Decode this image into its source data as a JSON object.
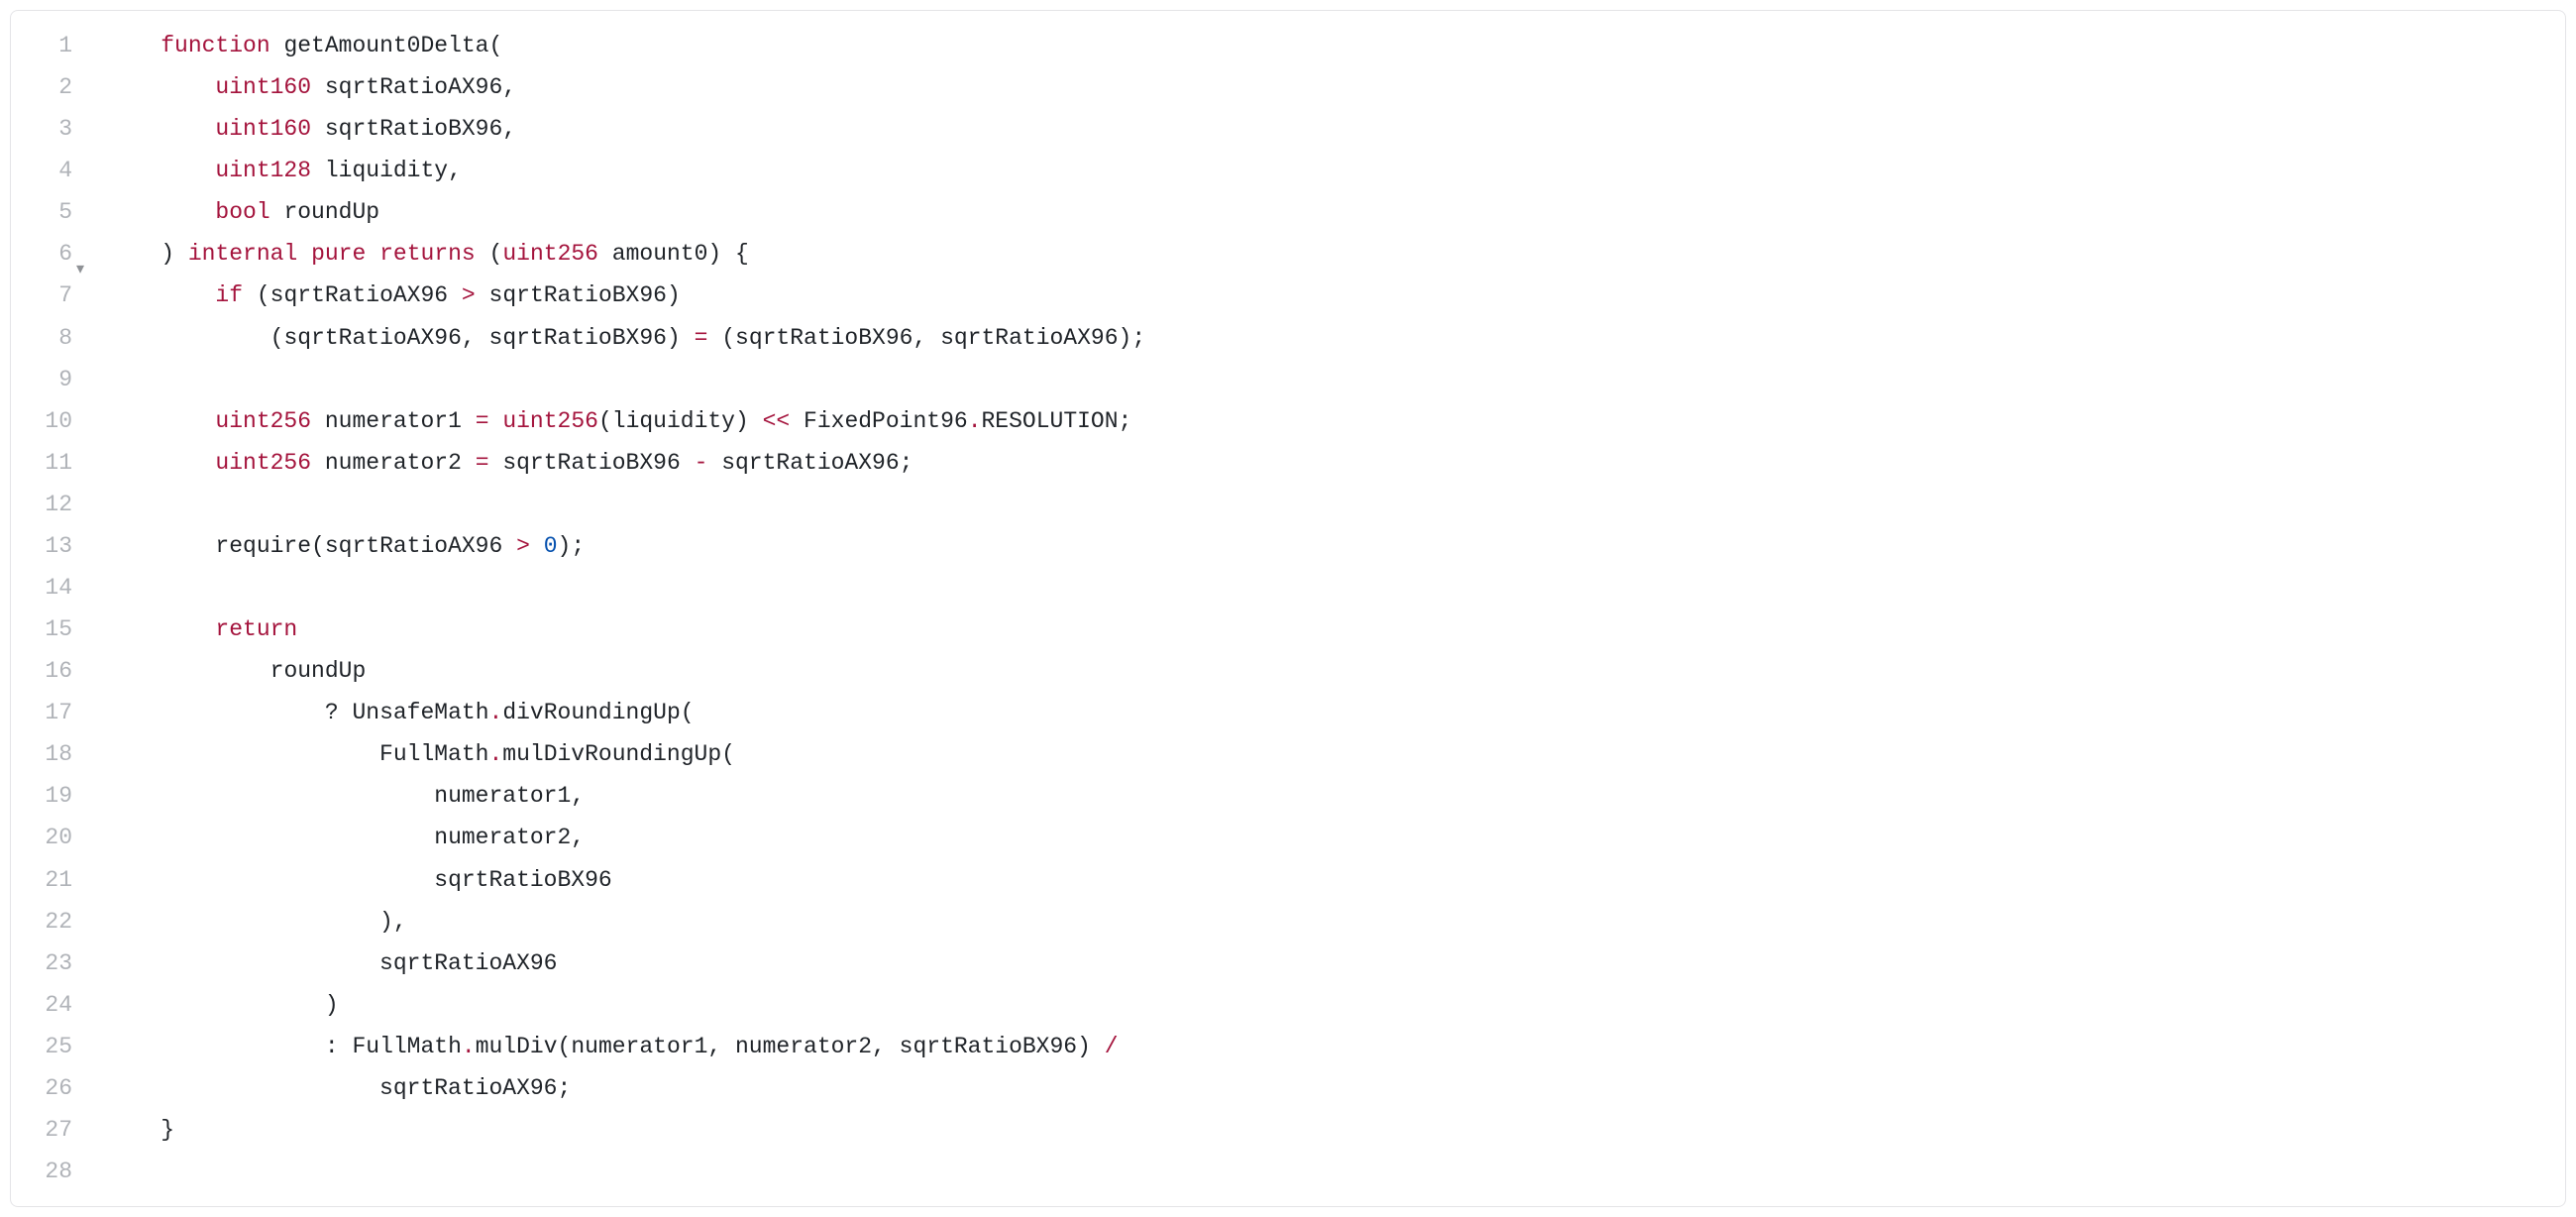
{
  "code": {
    "lines": [
      {
        "n": "1",
        "fold": "",
        "tokens": [
          {
            "cls": "",
            "t": "    "
          },
          {
            "cls": "tok-keyword",
            "t": "function"
          },
          {
            "cls": "",
            "t": " "
          },
          {
            "cls": "tok-ident",
            "t": "getAmount0Delta"
          },
          {
            "cls": "tok-punct",
            "t": "("
          }
        ]
      },
      {
        "n": "2",
        "fold": "",
        "tokens": [
          {
            "cls": "",
            "t": "        "
          },
          {
            "cls": "tok-type",
            "t": "uint160"
          },
          {
            "cls": "",
            "t": " "
          },
          {
            "cls": "tok-ident",
            "t": "sqrtRatioAX96"
          },
          {
            "cls": "tok-punct",
            "t": ","
          }
        ]
      },
      {
        "n": "3",
        "fold": "",
        "tokens": [
          {
            "cls": "",
            "t": "        "
          },
          {
            "cls": "tok-type",
            "t": "uint160"
          },
          {
            "cls": "",
            "t": " "
          },
          {
            "cls": "tok-ident",
            "t": "sqrtRatioBX96"
          },
          {
            "cls": "tok-punct",
            "t": ","
          }
        ]
      },
      {
        "n": "4",
        "fold": "",
        "tokens": [
          {
            "cls": "",
            "t": "        "
          },
          {
            "cls": "tok-type",
            "t": "uint128"
          },
          {
            "cls": "",
            "t": " "
          },
          {
            "cls": "tok-ident",
            "t": "liquidity"
          },
          {
            "cls": "tok-punct",
            "t": ","
          }
        ]
      },
      {
        "n": "5",
        "fold": "",
        "tokens": [
          {
            "cls": "",
            "t": "        "
          },
          {
            "cls": "tok-type",
            "t": "bool"
          },
          {
            "cls": "",
            "t": " "
          },
          {
            "cls": "tok-ident",
            "t": "roundUp"
          }
        ]
      },
      {
        "n": "6",
        "fold": "▾",
        "tokens": [
          {
            "cls": "",
            "t": "    "
          },
          {
            "cls": "tok-punct",
            "t": ")"
          },
          {
            "cls": "",
            "t": " "
          },
          {
            "cls": "tok-mod",
            "t": "internal"
          },
          {
            "cls": "",
            "t": " "
          },
          {
            "cls": "tok-mod",
            "t": "pure"
          },
          {
            "cls": "",
            "t": " "
          },
          {
            "cls": "tok-keyword",
            "t": "returns"
          },
          {
            "cls": "",
            "t": " "
          },
          {
            "cls": "tok-punct",
            "t": "("
          },
          {
            "cls": "tok-type",
            "t": "uint256"
          },
          {
            "cls": "",
            "t": " "
          },
          {
            "cls": "tok-ident",
            "t": "amount0"
          },
          {
            "cls": "tok-punct",
            "t": ")"
          },
          {
            "cls": "",
            "t": " "
          },
          {
            "cls": "tok-punct",
            "t": "{"
          }
        ]
      },
      {
        "n": "7",
        "fold": "",
        "tokens": [
          {
            "cls": "",
            "t": "        "
          },
          {
            "cls": "tok-keyword",
            "t": "if"
          },
          {
            "cls": "",
            "t": " "
          },
          {
            "cls": "tok-punct",
            "t": "("
          },
          {
            "cls": "tok-ident",
            "t": "sqrtRatioAX96"
          },
          {
            "cls": "",
            "t": " "
          },
          {
            "cls": "tok-op-red",
            "t": ">"
          },
          {
            "cls": "",
            "t": " "
          },
          {
            "cls": "tok-ident",
            "t": "sqrtRatioBX96"
          },
          {
            "cls": "tok-punct",
            "t": ")"
          }
        ]
      },
      {
        "n": "8",
        "fold": "",
        "tokens": [
          {
            "cls": "",
            "t": "            "
          },
          {
            "cls": "tok-punct",
            "t": "("
          },
          {
            "cls": "tok-ident",
            "t": "sqrtRatioAX96"
          },
          {
            "cls": "tok-punct",
            "t": ","
          },
          {
            "cls": "",
            "t": " "
          },
          {
            "cls": "tok-ident",
            "t": "sqrtRatioBX96"
          },
          {
            "cls": "tok-punct",
            "t": ")"
          },
          {
            "cls": "",
            "t": " "
          },
          {
            "cls": "tok-op-red",
            "t": "="
          },
          {
            "cls": "",
            "t": " "
          },
          {
            "cls": "tok-punct",
            "t": "("
          },
          {
            "cls": "tok-ident",
            "t": "sqrtRatioBX96"
          },
          {
            "cls": "tok-punct",
            "t": ","
          },
          {
            "cls": "",
            "t": " "
          },
          {
            "cls": "tok-ident",
            "t": "sqrtRatioAX96"
          },
          {
            "cls": "tok-punct",
            "t": ")"
          },
          {
            "cls": "tok-punct",
            "t": ";"
          }
        ]
      },
      {
        "n": "9",
        "fold": "",
        "tokens": [
          {
            "cls": "",
            "t": ""
          }
        ]
      },
      {
        "n": "10",
        "fold": "",
        "tokens": [
          {
            "cls": "",
            "t": "        "
          },
          {
            "cls": "tok-type",
            "t": "uint256"
          },
          {
            "cls": "",
            "t": " "
          },
          {
            "cls": "tok-ident",
            "t": "numerator1"
          },
          {
            "cls": "",
            "t": " "
          },
          {
            "cls": "tok-op-red",
            "t": "="
          },
          {
            "cls": "",
            "t": " "
          },
          {
            "cls": "tok-type",
            "t": "uint256"
          },
          {
            "cls": "tok-punct",
            "t": "("
          },
          {
            "cls": "tok-ident",
            "t": "liquidity"
          },
          {
            "cls": "tok-punct",
            "t": ")"
          },
          {
            "cls": "",
            "t": " "
          },
          {
            "cls": "tok-op-red",
            "t": "<<"
          },
          {
            "cls": "",
            "t": " "
          },
          {
            "cls": "tok-ident",
            "t": "FixedPoint96"
          },
          {
            "cls": "tok-dot",
            "t": "."
          },
          {
            "cls": "tok-ident",
            "t": "RESOLUTION"
          },
          {
            "cls": "tok-punct",
            "t": ";"
          }
        ]
      },
      {
        "n": "11",
        "fold": "",
        "tokens": [
          {
            "cls": "",
            "t": "        "
          },
          {
            "cls": "tok-type",
            "t": "uint256"
          },
          {
            "cls": "",
            "t": " "
          },
          {
            "cls": "tok-ident",
            "t": "numerator2"
          },
          {
            "cls": "",
            "t": " "
          },
          {
            "cls": "tok-op-red",
            "t": "="
          },
          {
            "cls": "",
            "t": " "
          },
          {
            "cls": "tok-ident",
            "t": "sqrtRatioBX96"
          },
          {
            "cls": "",
            "t": " "
          },
          {
            "cls": "tok-op-red",
            "t": "-"
          },
          {
            "cls": "",
            "t": " "
          },
          {
            "cls": "tok-ident",
            "t": "sqrtRatioAX96"
          },
          {
            "cls": "tok-punct",
            "t": ";"
          }
        ]
      },
      {
        "n": "12",
        "fold": "",
        "tokens": [
          {
            "cls": "",
            "t": ""
          }
        ]
      },
      {
        "n": "13",
        "fold": "",
        "tokens": [
          {
            "cls": "",
            "t": "        "
          },
          {
            "cls": "tok-ident",
            "t": "require"
          },
          {
            "cls": "tok-punct",
            "t": "("
          },
          {
            "cls": "tok-ident",
            "t": "sqrtRatioAX96"
          },
          {
            "cls": "",
            "t": " "
          },
          {
            "cls": "tok-op-red",
            "t": ">"
          },
          {
            "cls": "",
            "t": " "
          },
          {
            "cls": "tok-num",
            "t": "0"
          },
          {
            "cls": "tok-punct",
            "t": ")"
          },
          {
            "cls": "tok-punct",
            "t": ";"
          }
        ]
      },
      {
        "n": "14",
        "fold": "",
        "tokens": [
          {
            "cls": "",
            "t": ""
          }
        ]
      },
      {
        "n": "15",
        "fold": "",
        "tokens": [
          {
            "cls": "",
            "t": "        "
          },
          {
            "cls": "tok-keyword",
            "t": "return"
          }
        ]
      },
      {
        "n": "16",
        "fold": "",
        "tokens": [
          {
            "cls": "",
            "t": "            "
          },
          {
            "cls": "tok-ident",
            "t": "roundUp"
          }
        ]
      },
      {
        "n": "17",
        "fold": "",
        "tokens": [
          {
            "cls": "",
            "t": "                "
          },
          {
            "cls": "tok-punct",
            "t": "?"
          },
          {
            "cls": "",
            "t": " "
          },
          {
            "cls": "tok-ident",
            "t": "UnsafeMath"
          },
          {
            "cls": "tok-dot",
            "t": "."
          },
          {
            "cls": "tok-ident",
            "t": "divRoundingUp"
          },
          {
            "cls": "tok-punct",
            "t": "("
          }
        ]
      },
      {
        "n": "18",
        "fold": "",
        "tokens": [
          {
            "cls": "",
            "t": "                    "
          },
          {
            "cls": "tok-ident",
            "t": "FullMath"
          },
          {
            "cls": "tok-dot",
            "t": "."
          },
          {
            "cls": "tok-ident",
            "t": "mulDivRoundingUp"
          },
          {
            "cls": "tok-punct",
            "t": "("
          }
        ]
      },
      {
        "n": "19",
        "fold": "",
        "tokens": [
          {
            "cls": "",
            "t": "                        "
          },
          {
            "cls": "tok-ident",
            "t": "numerator1"
          },
          {
            "cls": "tok-punct",
            "t": ","
          }
        ]
      },
      {
        "n": "20",
        "fold": "",
        "tokens": [
          {
            "cls": "",
            "t": "                        "
          },
          {
            "cls": "tok-ident",
            "t": "numerator2"
          },
          {
            "cls": "tok-punct",
            "t": ","
          }
        ]
      },
      {
        "n": "21",
        "fold": "",
        "tokens": [
          {
            "cls": "",
            "t": "                        "
          },
          {
            "cls": "tok-ident",
            "t": "sqrtRatioBX96"
          }
        ]
      },
      {
        "n": "22",
        "fold": "",
        "tokens": [
          {
            "cls": "",
            "t": "                    "
          },
          {
            "cls": "tok-punct",
            "t": ")"
          },
          {
            "cls": "tok-punct",
            "t": ","
          }
        ]
      },
      {
        "n": "23",
        "fold": "",
        "tokens": [
          {
            "cls": "",
            "t": "                    "
          },
          {
            "cls": "tok-ident",
            "t": "sqrtRatioAX96"
          }
        ]
      },
      {
        "n": "24",
        "fold": "",
        "tokens": [
          {
            "cls": "",
            "t": "                "
          },
          {
            "cls": "tok-punct",
            "t": ")"
          }
        ]
      },
      {
        "n": "25",
        "fold": "",
        "tokens": [
          {
            "cls": "",
            "t": "                "
          },
          {
            "cls": "tok-punct",
            "t": ":"
          },
          {
            "cls": "",
            "t": " "
          },
          {
            "cls": "tok-ident",
            "t": "FullMath"
          },
          {
            "cls": "tok-dot",
            "t": "."
          },
          {
            "cls": "tok-ident",
            "t": "mulDiv"
          },
          {
            "cls": "tok-punct",
            "t": "("
          },
          {
            "cls": "tok-ident",
            "t": "numerator1"
          },
          {
            "cls": "tok-punct",
            "t": ","
          },
          {
            "cls": "",
            "t": " "
          },
          {
            "cls": "tok-ident",
            "t": "numerator2"
          },
          {
            "cls": "tok-punct",
            "t": ","
          },
          {
            "cls": "",
            "t": " "
          },
          {
            "cls": "tok-ident",
            "t": "sqrtRatioBX96"
          },
          {
            "cls": "tok-punct",
            "t": ")"
          },
          {
            "cls": "",
            "t": " "
          },
          {
            "cls": "tok-op-red",
            "t": "/"
          }
        ]
      },
      {
        "n": "26",
        "fold": "",
        "tokens": [
          {
            "cls": "",
            "t": "                    "
          },
          {
            "cls": "tok-ident",
            "t": "sqrtRatioAX96"
          },
          {
            "cls": "tok-punct",
            "t": ";"
          }
        ]
      },
      {
        "n": "27",
        "fold": "",
        "tokens": [
          {
            "cls": "",
            "t": "    "
          },
          {
            "cls": "tok-punct",
            "t": "}"
          }
        ]
      },
      {
        "n": "28",
        "fold": "",
        "tokens": [
          {
            "cls": "",
            "t": ""
          }
        ]
      }
    ]
  }
}
